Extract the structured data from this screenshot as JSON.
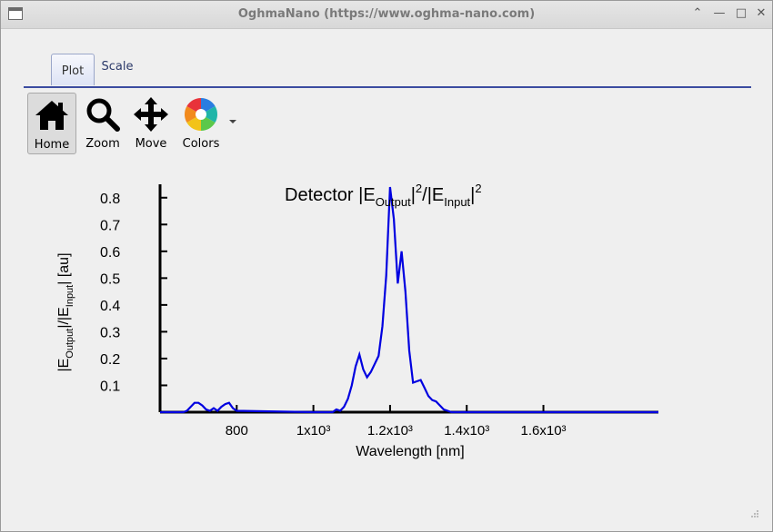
{
  "window": {
    "title": "OghmaNano (https://www.oghma-nano.com)"
  },
  "tabs": [
    {
      "label": "Plot",
      "active": true
    },
    {
      "label": "Scale",
      "active": false
    }
  ],
  "toolbar": {
    "home_label": "Home",
    "zoom_label": "Zoom",
    "move_label": "Move",
    "colors_label": "Colors"
  },
  "icons": {
    "home": "home-icon",
    "zoom": "magnifier-icon",
    "move": "move-arrows-icon",
    "colors": "color-wheel-icon"
  },
  "chart_data": {
    "type": "line",
    "title": "Detector |E_Output|²/|E_Input|²",
    "title_main": "Detector |E",
    "title_sub1": "Output",
    "title_mid": "|",
    "title_sup1": "2",
    "title_mid2": "/|E",
    "title_sub2": "Input",
    "title_end": "|",
    "title_sup2": "2",
    "xlabel": "Wavelength [nm]",
    "ylabel": "|E_Output|/|E_Input| [au]",
    "ylabel_parts": [
      "|E",
      "Output",
      "|/|E",
      "Input",
      "| [au]"
    ],
    "xlim": [
      600,
      1900
    ],
    "ylim": [
      0,
      0.85
    ],
    "xticks": [
      {
        "value": 800,
        "label": "800"
      },
      {
        "value": 1000,
        "label": "1x10³"
      },
      {
        "value": 1200,
        "label": "1.2x10³"
      },
      {
        "value": 1400,
        "label": "1.4x10³"
      },
      {
        "value": 1600,
        "label": "1.6x10³"
      }
    ],
    "yticks": [
      0.1,
      0.2,
      0.3,
      0.4,
      0.5,
      0.6,
      0.7,
      0.8
    ],
    "series": [
      {
        "color": "#0000e0",
        "x": [
          600,
          660,
          670,
          680,
          690,
          700,
          710,
          720,
          730,
          740,
          750,
          760,
          770,
          780,
          790,
          800,
          1000,
          1050,
          1060,
          1070,
          1080,
          1090,
          1100,
          1110,
          1120,
          1130,
          1140,
          1150,
          1160,
          1170,
          1180,
          1190,
          1200,
          1210,
          1220,
          1230,
          1240,
          1250,
          1260,
          1270,
          1280,
          1290,
          1300,
          1310,
          1320,
          1330,
          1340,
          1350,
          1360,
          1900
        ],
        "y": [
          0,
          0,
          0.005,
          0.02,
          0.035,
          0.035,
          0.025,
          0.01,
          0.005,
          0.015,
          0.005,
          0.02,
          0.03,
          0.035,
          0.015,
          0.005,
          0,
          0,
          0.01,
          0.005,
          0.02,
          0.05,
          0.1,
          0.17,
          0.215,
          0.16,
          0.13,
          0.15,
          0.18,
          0.21,
          0.32,
          0.51,
          0.84,
          0.72,
          0.48,
          0.6,
          0.45,
          0.23,
          0.11,
          0.115,
          0.12,
          0.09,
          0.06,
          0.045,
          0.04,
          0.025,
          0.01,
          0.005,
          0,
          0
        ]
      }
    ]
  }
}
